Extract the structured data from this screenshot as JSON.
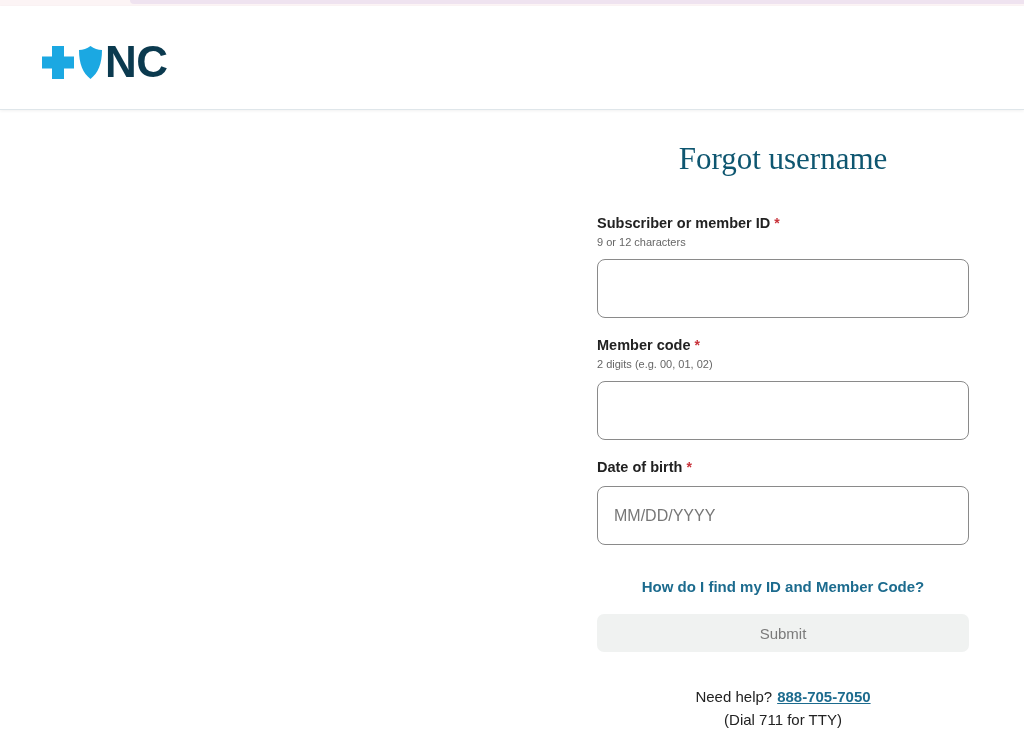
{
  "header": {
    "logo": {
      "text": "NC"
    }
  },
  "form": {
    "title": "Forgot username",
    "fields": [
      {
        "label": "Subscriber or member ID",
        "required_mark": "*",
        "hint": "9 or 12 characters"
      },
      {
        "label": "Member code",
        "required_mark": "*",
        "hint": "2 digits (e.g. 00, 01, 02)"
      },
      {
        "label": "Date of birth",
        "required_mark": "*",
        "placeholder": "MM/DD/YYYY"
      }
    ],
    "help_link": "How do I find my ID and Member Code?",
    "submit": {
      "label": "Submit",
      "disabled": true
    },
    "help": {
      "text": "Need help?",
      "phone": "888-705-7050",
      "note": "(Dial 711 for TTY)"
    }
  }
}
